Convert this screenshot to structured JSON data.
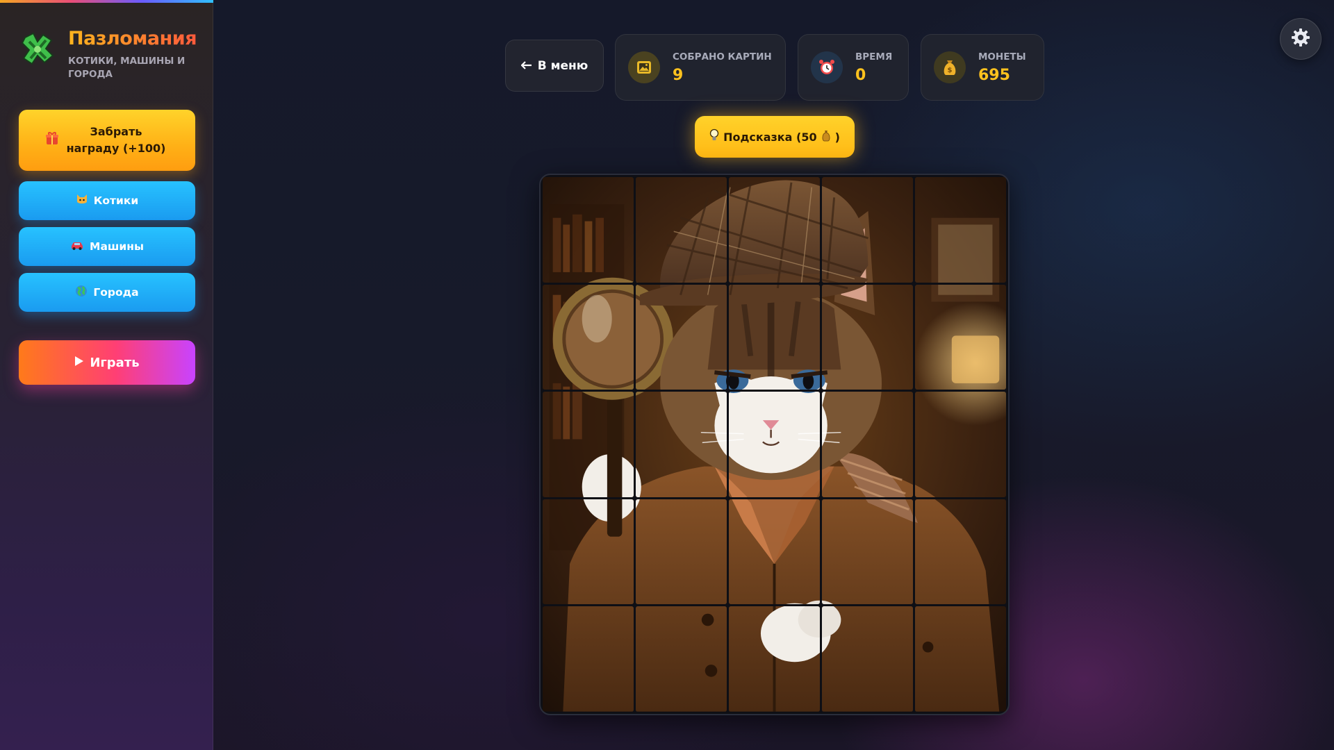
{
  "sidebar": {
    "title": "Пазломания",
    "subtitle": "Котики, машины и города",
    "reward_button": "Забрать награду (+100)",
    "categories": [
      {
        "label": "Котики",
        "icon": "cat-face-icon"
      },
      {
        "label": "Машины",
        "icon": "car-icon"
      },
      {
        "label": "Города",
        "icon": "globe-icon"
      }
    ],
    "play_button": "Играть"
  },
  "topbar": {
    "menu_button": "В меню",
    "stats": [
      {
        "label": "Собрано картин",
        "value": "9",
        "icon": "picture-icon"
      },
      {
        "label": "Время",
        "value": "0",
        "icon": "alarm-clock-icon"
      },
      {
        "label": "Монеты",
        "value": "695",
        "icon": "money-bag-icon"
      }
    ],
    "hint_button": "Подсказка (50",
    "hint_button_end": ")"
  },
  "puzzle": {
    "rows": 5,
    "cols": 5,
    "image": "Cat detective in a deerstalker hat and trench coat holding a magnifying glass"
  },
  "colors": {
    "accent_yellow": "#ffc21e",
    "button_blue": "#1a9bf0",
    "play_gradient_start": "#ff7a1a",
    "play_gradient_end": "#c843ff"
  }
}
